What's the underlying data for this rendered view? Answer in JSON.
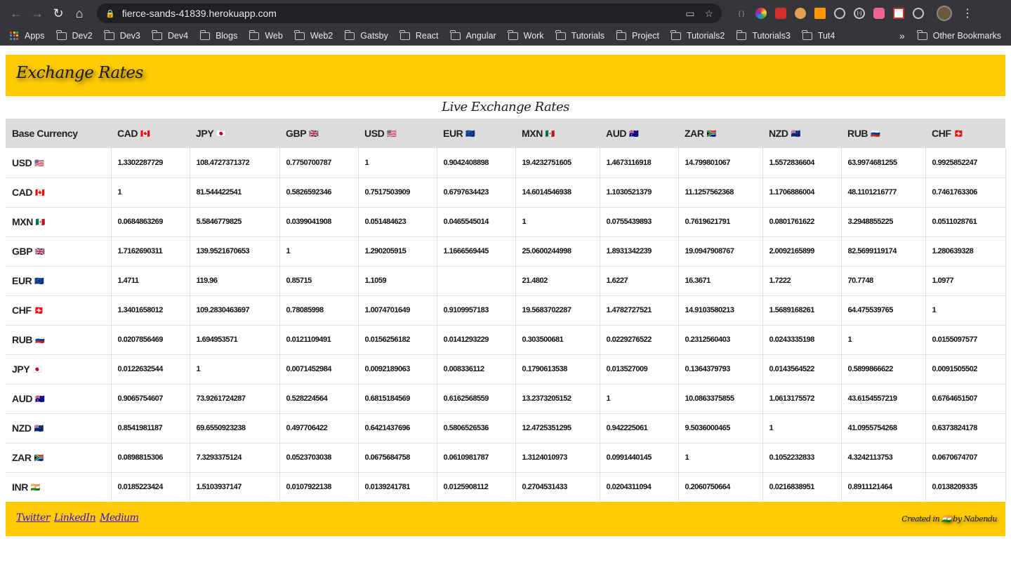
{
  "browser": {
    "url": "fierce-sands-41839.herokuapp.com",
    "bookmarks": [
      "Apps",
      "Dev2",
      "Dev3",
      "Dev4",
      "Blogs",
      "Web",
      "Web2",
      "Gatsby",
      "React",
      "Angular",
      "Work",
      "Tutorials",
      "Project",
      "Tutorials2",
      "Tutorials3",
      "Tut4"
    ],
    "more": "»",
    "other_bookmarks": "Other Bookmarks"
  },
  "header": {
    "title": "Exchange Rates"
  },
  "table": {
    "caption": "Live Exchange Rates",
    "base_header": "Base Currency",
    "columns": [
      {
        "code": "CAD",
        "flag": "🇨🇦"
      },
      {
        "code": "JPY",
        "flag": "🇯🇵"
      },
      {
        "code": "GBP",
        "flag": "🇬🇧"
      },
      {
        "code": "USD",
        "flag": "🇺🇸"
      },
      {
        "code": "EUR",
        "flag": "🇪🇺"
      },
      {
        "code": "MXN",
        "flag": "🇲🇽"
      },
      {
        "code": "AUD",
        "flag": "🇦🇺"
      },
      {
        "code": "ZAR",
        "flag": "🇿🇦"
      },
      {
        "code": "NZD",
        "flag": "🇳🇿"
      },
      {
        "code": "RUB",
        "flag": "🇷🇺"
      },
      {
        "code": "CHF",
        "flag": "🇨🇭"
      }
    ],
    "rows": [
      {
        "base": "USD",
        "flag": "🇺🇸",
        "values": [
          "1.3302287729",
          "108.4727371372",
          "0.7750700787",
          "1",
          "0.9042408898",
          "19.4232751605",
          "1.4673116918",
          "14.799801067",
          "1.5572836604",
          "63.9974681255",
          "0.9925852247"
        ]
      },
      {
        "base": "CAD",
        "flag": "🇨🇦",
        "values": [
          "1",
          "81.544422541",
          "0.5826592346",
          "0.7517503909",
          "0.6797634423",
          "14.6014546938",
          "1.1030521379",
          "11.1257562368",
          "1.1706886004",
          "48.1101216777",
          "0.7461763306"
        ]
      },
      {
        "base": "MXN",
        "flag": "🇲🇽",
        "values": [
          "0.0684863269",
          "5.5846779825",
          "0.0399041908",
          "0.051484623",
          "0.0465545014",
          "1",
          "0.0755439893",
          "0.7619621791",
          "0.0801761622",
          "3.2948855225",
          "0.0511028761"
        ]
      },
      {
        "base": "GBP",
        "flag": "🇬🇧",
        "values": [
          "1.7162690311",
          "139.9521670653",
          "1",
          "1.290205915",
          "1.1666569445",
          "25.0600244998",
          "1.8931342239",
          "19.0947908767",
          "2.0092165899",
          "82.5699119174",
          "1.280639328"
        ]
      },
      {
        "base": "EUR",
        "flag": "🇪🇺",
        "values": [
          "1.4711",
          "119.96",
          "0.85715",
          "1.1059",
          "",
          "21.4802",
          "1.6227",
          "16.3671",
          "1.7222",
          "70.7748",
          "1.0977"
        ]
      },
      {
        "base": "CHF",
        "flag": "🇨🇭",
        "values": [
          "1.3401658012",
          "109.2830463697",
          "0.78085998",
          "1.0074701649",
          "0.9109957183",
          "19.5683702287",
          "1.4782727521",
          "14.9103580213",
          "1.5689168261",
          "64.475539765",
          "1"
        ]
      },
      {
        "base": "RUB",
        "flag": "🇷🇺",
        "values": [
          "0.0207856469",
          "1.694953571",
          "0.0121109491",
          "0.0156256182",
          "0.0141293229",
          "0.303500681",
          "0.0229276522",
          "0.2312560403",
          "0.0243335198",
          "1",
          "0.0155097577"
        ]
      },
      {
        "base": "JPY",
        "flag": "🇯🇵",
        "values": [
          "0.0122632544",
          "1",
          "0.0071452984",
          "0.0092189063",
          "0.008336112",
          "0.1790613538",
          "0.013527009",
          "0.1364379793",
          "0.0143564522",
          "0.5899866622",
          "0.0091505502"
        ]
      },
      {
        "base": "AUD",
        "flag": "🇦🇺",
        "values": [
          "0.9065754607",
          "73.9261724287",
          "0.528224564",
          "0.6815184569",
          "0.6162568559",
          "13.2373205152",
          "1",
          "10.0863375855",
          "1.0613175572",
          "43.6154557219",
          "0.6764651507"
        ]
      },
      {
        "base": "NZD",
        "flag": "🇳🇿",
        "values": [
          "0.8541981187",
          "69.6550923238",
          "0.497706422",
          "0.6421437696",
          "0.5806526536",
          "12.4725351295",
          "0.942225061",
          "9.5036000465",
          "1",
          "41.0955754268",
          "0.6373824178"
        ]
      },
      {
        "base": "ZAR",
        "flag": "🇿🇦",
        "values": [
          "0.0898815306",
          "7.3293375124",
          "0.0523703038",
          "0.0675684758",
          "0.0610981787",
          "1.3124010973",
          "0.0991440145",
          "1",
          "0.1052232833",
          "4.3242113753",
          "0.0670674707"
        ]
      },
      {
        "base": "INR",
        "flag": "🇮🇳",
        "values": [
          "0.0185223424",
          "1.5103937147",
          "0.0107922138",
          "0.0139241781",
          "0.0125908112",
          "0.2704531433",
          "0.0204311094",
          "0.2060750664",
          "0.0216838951",
          "0.8911121464",
          "0.0138209335"
        ]
      }
    ]
  },
  "footer": {
    "links": [
      "Twitter",
      "LinkedIn",
      "Medium"
    ],
    "credit_prefix": "Created in",
    "credit_flag": "🇮🇳",
    "credit_suffix": "by Nabendu"
  }
}
